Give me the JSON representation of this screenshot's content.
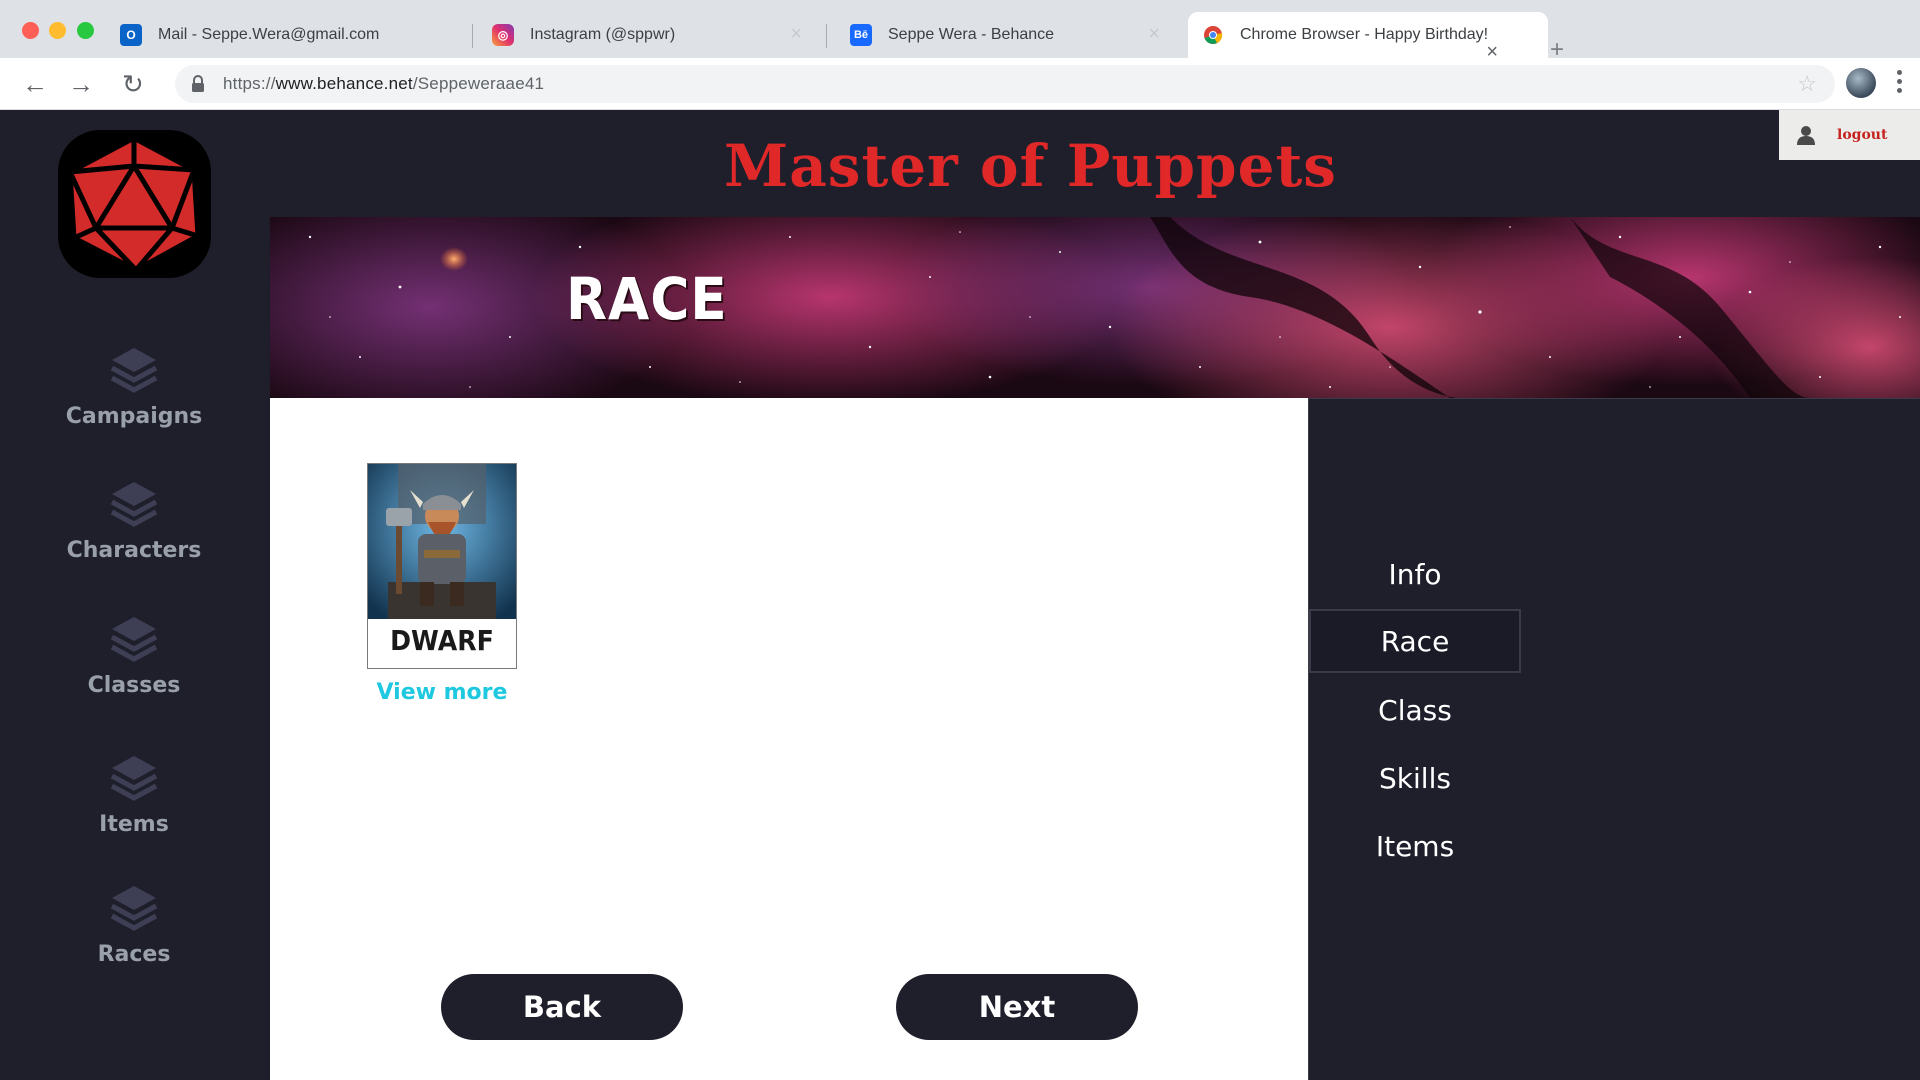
{
  "browser": {
    "tabs": [
      {
        "title": "Mail - Seppe.Wera@gmail.com",
        "icon": "outlook-icon"
      },
      {
        "title": "Instagram (@sppwr)",
        "icon": "instagram-icon"
      },
      {
        "title": "Seppe Wera - Behance",
        "icon": "behance-icon"
      },
      {
        "title": "Chrome Browser - Happy Birthday!",
        "icon": "chrome-icon",
        "active": true
      }
    ],
    "address": {
      "scheme": "https://",
      "domain": "www.behance.net",
      "path": "/Seppeweraae41"
    }
  },
  "app": {
    "title": "Master of Puppets",
    "logout_label": "logout",
    "sidebar": {
      "items": [
        {
          "label": "Campaigns",
          "icon": "layers-icon"
        },
        {
          "label": "Characters",
          "icon": "layers-icon"
        },
        {
          "label": "Classes",
          "icon": "layers-icon"
        },
        {
          "label": "Items",
          "icon": "layers-icon"
        },
        {
          "label": "Races",
          "icon": "layers-icon"
        }
      ]
    },
    "banner": {
      "title": "RACE"
    },
    "race_cards": [
      {
        "name": "DWARF",
        "link_label": "View more"
      }
    ],
    "buttons": {
      "back": "Back",
      "next": "Next"
    },
    "steps": [
      {
        "label": "Info"
      },
      {
        "label": "Race",
        "active": true
      },
      {
        "label": "Class"
      },
      {
        "label": "Skills"
      },
      {
        "label": "Items"
      }
    ]
  },
  "colors": {
    "accent_red": "#e02828",
    "dark_bg": "#1f1f2c",
    "link_cyan": "#1ec8e0"
  }
}
